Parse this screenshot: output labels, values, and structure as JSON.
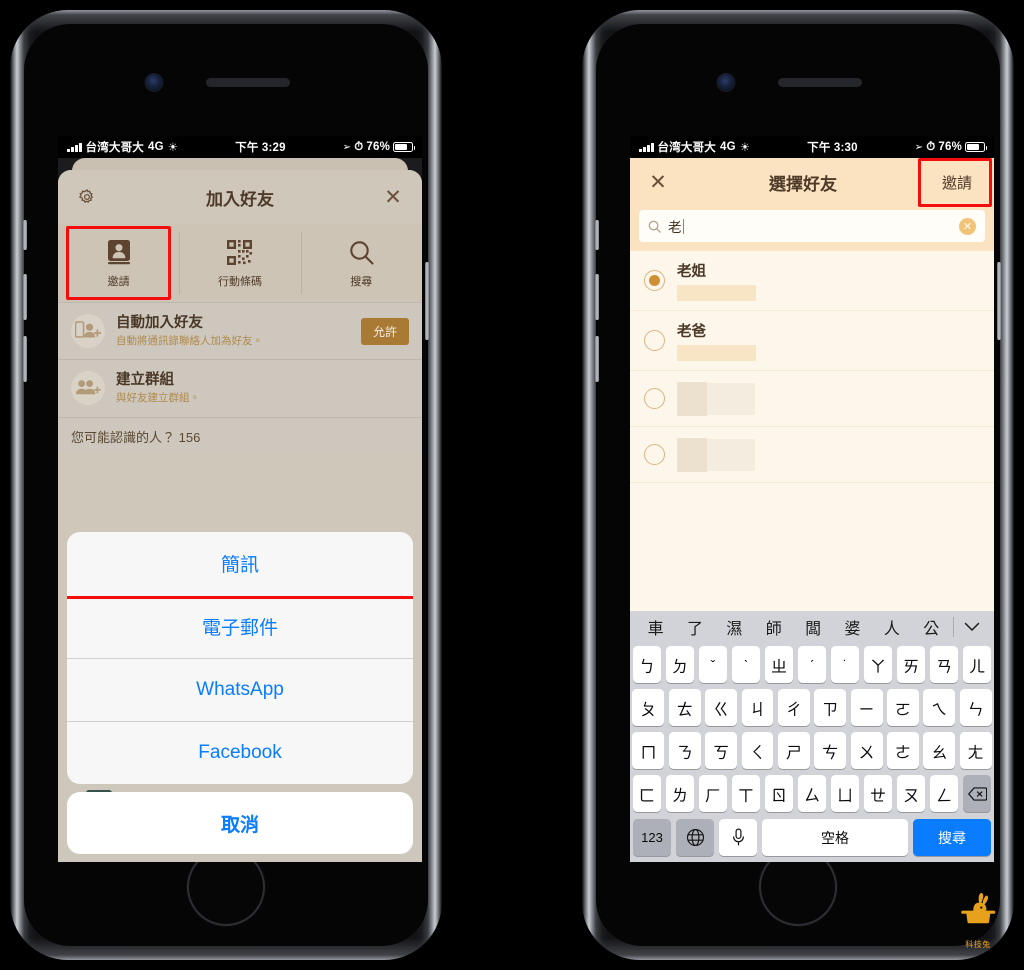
{
  "left_phone": {
    "status_bar": {
      "carrier": "台湾大哥大",
      "network": "4G",
      "time": "下午 3:29",
      "battery_percent": "76%"
    },
    "sheet": {
      "title": "加入好友",
      "gear_icon": "gear-icon",
      "close_icon": "close-icon",
      "tabs": [
        {
          "label": "邀請",
          "icon": "address-book-icon",
          "highlighted": true
        },
        {
          "label": "行動條碼",
          "icon": "qr-code-icon",
          "highlighted": false
        },
        {
          "label": "搜尋",
          "icon": "search-icon",
          "highlighted": false
        }
      ],
      "rows": [
        {
          "title": "自動加入好友",
          "subtitle": "自動將通訊錄聯絡人加為好友。",
          "action_label": "允許",
          "icon": "phone-add-friend-icon"
        },
        {
          "title": "建立群組",
          "subtitle": "與好友建立群組。",
          "action_label": "",
          "icon": "group-add-icon"
        }
      ],
      "section_header": "您可能認識的人？ 156"
    },
    "action_sheet": {
      "items": [
        {
          "label": "簡訊",
          "highlighted": true
        },
        {
          "label": "電子郵件",
          "highlighted": false
        },
        {
          "label": "WhatsApp",
          "highlighted": false
        },
        {
          "label": "Facebook",
          "highlighted": false
        }
      ],
      "cancel_label": "取消"
    }
  },
  "right_phone": {
    "status_bar": {
      "carrier": "台湾大哥大",
      "network": "4G",
      "time": "下午 3:30",
      "battery_percent": "76%"
    },
    "nav": {
      "close_icon": "close-icon",
      "title": "選擇好友",
      "action_label": "邀請",
      "action_highlighted": true
    },
    "search": {
      "icon": "search-icon",
      "value": "老",
      "clear_icon": "clear-circle-icon"
    },
    "friends": [
      {
        "name": "老姐",
        "selected": true,
        "redacted": true
      },
      {
        "name": "老爸",
        "selected": false,
        "redacted": true
      },
      {
        "name": "",
        "selected": false,
        "redacted": true
      },
      {
        "name": "",
        "selected": false,
        "redacted": true
      }
    ],
    "keyboard": {
      "candidates": [
        "車",
        "了",
        "濕",
        "師",
        "闆",
        "婆",
        "人",
        "公"
      ],
      "collapse_icon": "chevron-down-icon",
      "row1": [
        "ㄅ",
        "ㄉ",
        "ˇ",
        "ˋ",
        "ㄓ",
        "ˊ",
        "˙",
        "ㄚ",
        "ㄞ",
        "ㄢ",
        "ㄦ"
      ],
      "row2": [
        "ㄆ",
        "ㄊ",
        "ㄍ",
        "ㄐ",
        "ㄔ",
        "ㄗ",
        "ㄧ",
        "ㄛ",
        "ㄟ",
        "ㄣ"
      ],
      "row3": [
        "ㄇ",
        "ㄋ",
        "ㄎ",
        "ㄑ",
        "ㄕ",
        "ㄘ",
        "ㄨ",
        "ㄜ",
        "ㄠ",
        "ㄤ"
      ],
      "row4": [
        "ㄈ",
        "ㄌ",
        "ㄏ",
        "ㄒ",
        "ㄖ",
        "ㄙ",
        "ㄩ",
        "ㄝ",
        "ㄡ",
        "ㄥ"
      ],
      "backspace_icon": "backspace-icon",
      "numeric_label": "123",
      "globe_icon": "globe-icon",
      "mic_icon": "microphone-icon",
      "space_label": "空格",
      "search_label": "搜尋"
    }
  },
  "watermark": {
    "label": "科技兔",
    "icon": "rabbit-in-hat-icon",
    "color": "#e8a11c"
  },
  "colors": {
    "highlight": "#f40d0d",
    "sheet_bg": "#cfc7ba",
    "nav_bg": "#fbe2c0",
    "ios_blue": "#0a7cff",
    "allow_button": "#a87a33",
    "radio_selected": "#d18f33"
  }
}
